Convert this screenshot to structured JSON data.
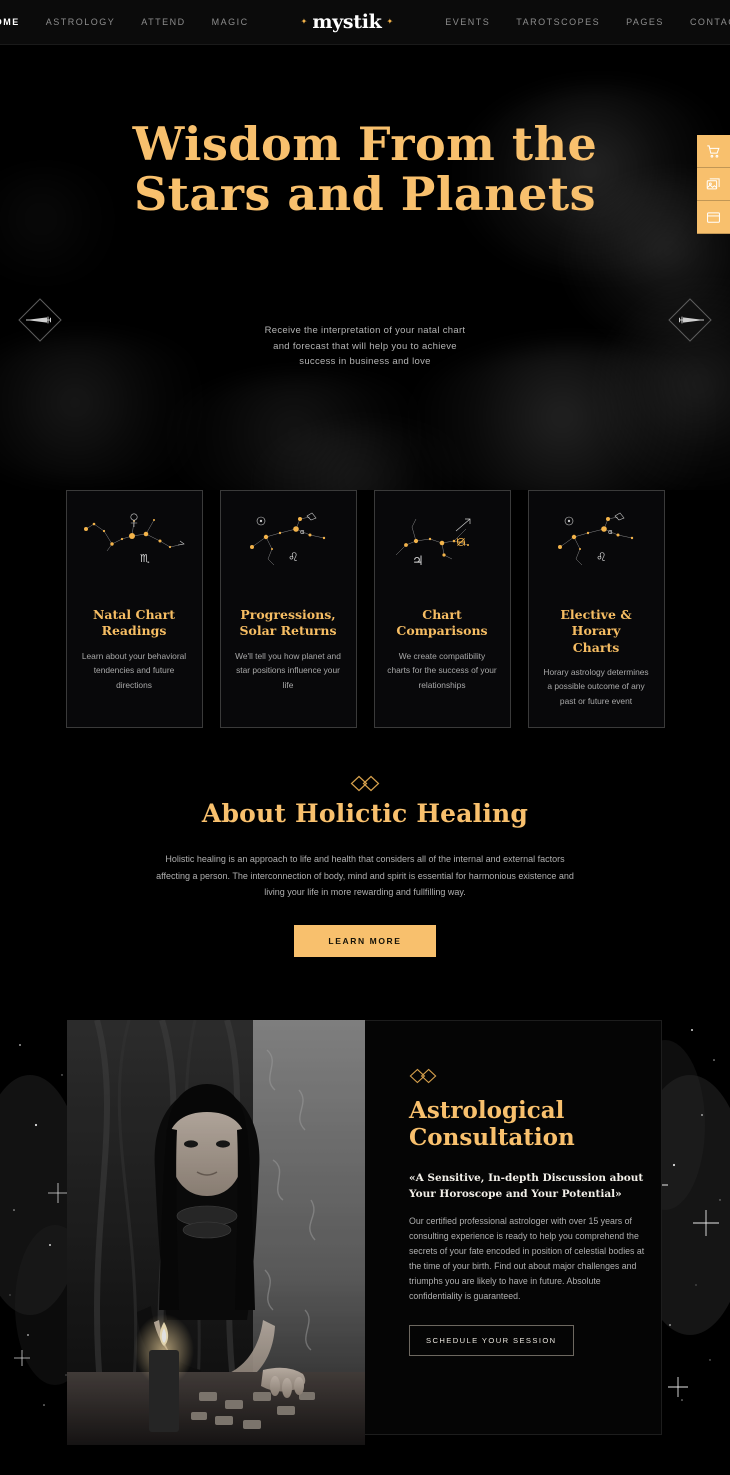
{
  "header": {
    "logo": {
      "text": "mystik",
      "star_left": "✦",
      "star_right": "✦"
    },
    "nav_left": [
      {
        "label": "HOME",
        "active": true
      },
      {
        "label": "ASTROLOGY",
        "active": false
      },
      {
        "label": "ATTEND",
        "active": false
      },
      {
        "label": "MAGIC",
        "active": false
      }
    ],
    "nav_right": [
      {
        "label": "EVENTS"
      },
      {
        "label": "TAROTSCOPES"
      },
      {
        "label": "PAGES"
      },
      {
        "label": "CONTACT"
      }
    ]
  },
  "hero": {
    "title_line1": "Wisdom From the",
    "title_line2": "Stars and Planets",
    "subtitle_line1": "Receive the interpretation of your natal chart",
    "subtitle_line2": "and forecast that will help you to achieve",
    "subtitle_line3": "success in business and love",
    "prev_label": "Previous slide",
    "next_label": "Next slide"
  },
  "floating_buttons": [
    {
      "icon": "shopping-cart-icon",
      "name": "cart"
    },
    {
      "icon": "gallery-icon",
      "name": "gallery"
    },
    {
      "icon": "window-icon",
      "name": "window"
    }
  ],
  "cards": [
    {
      "title_line1": "Natal Chart",
      "title_line2": "Readings",
      "desc": "Learn about your behavioral tendencies and future directions",
      "art": "scorpio-constellation"
    },
    {
      "title_line1": "Progressions,",
      "title_line2": "Solar Returns",
      "desc": "We'll tell you how planet and star positions influence your life",
      "art": "leo-constellation"
    },
    {
      "title_line1": "Chart",
      "title_line2": "Comparisons",
      "desc": "We create compatibility charts for the success of your relationships",
      "art": "sagittarius-constellation"
    },
    {
      "title_line1": "Elective & Horary",
      "title_line2": "Charts",
      "desc": "Horary astrology determines a possible outcome of any past or future event",
      "art": "leo-constellation"
    }
  ],
  "about": {
    "title": "About Holictic Healing",
    "text": "Holistic healing is an approach to life and health that considers all of the internal and external factors affecting a person. The interconnection of body, mind and spirit is essential for harmonious existence and living your life in more rewarding and fullfilling way.",
    "button_label": "LEARN MORE"
  },
  "consultation": {
    "title_line1": "Astrological",
    "title_line2": "Consultation",
    "quote_line1": "«A Sensitive, In-depth Discussion about",
    "quote_line2": "Your Horoscope and Your Potential»",
    "text": "Our certified professional astrologer with over 15 years of consulting experience is ready to help you comprehend the secrets of your fate encoded in position of celestial bodies at the time of your birth. Find out about major challenges and triumphs you are likely to have in future. Absolute confidentiality is guaranteed.",
    "button_label": "SCHEDULE YOUR SESSION",
    "photo_alt": "Woman at table with candle and rune stones"
  },
  "colors": {
    "gold": "#f8c06d",
    "gold_title": "#f6bd63",
    "background": "#000000",
    "card_bg": "#08080a",
    "card_border": "#3a3a3a",
    "body_text": "#b0b0b0",
    "nav_inactive": "#8d8d8d"
  }
}
